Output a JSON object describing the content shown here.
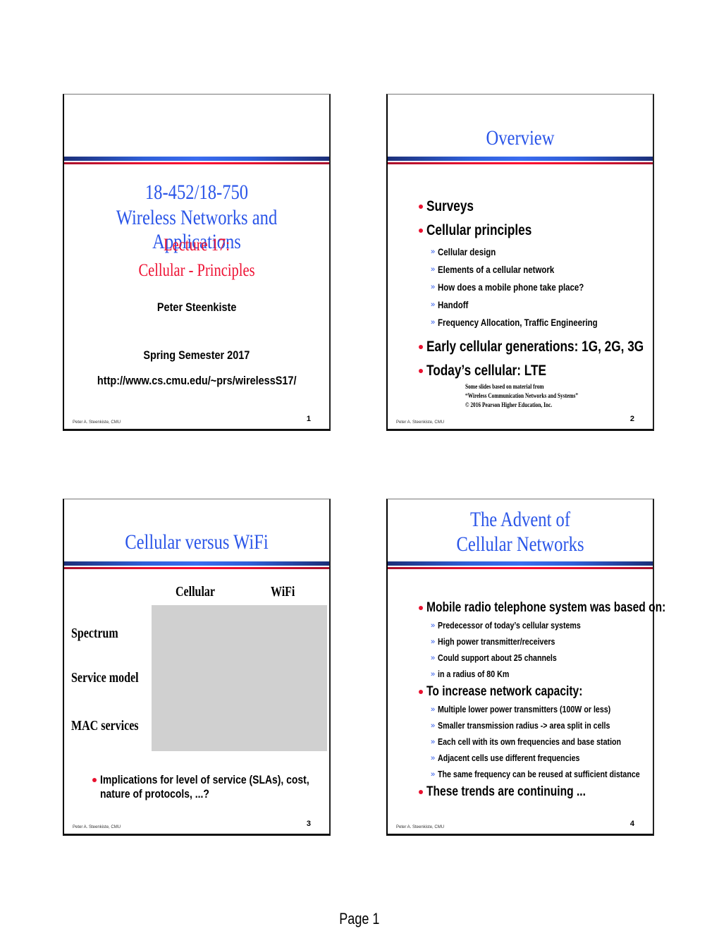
{
  "page": {
    "label": "Page 1"
  },
  "colors": {
    "title_blue": "#2a55e8",
    "accent_red": "#ee1133",
    "bullet_red": "#e8102e",
    "table_gray": "#d0d0d0"
  },
  "footer_author": "Peter A. Steenkiste, CMU",
  "slides": [
    {
      "number": "1",
      "course": "18-452/18-750",
      "course_title": "Wireless Networks and Applications",
      "lecture": "Lecture 17:",
      "topic": "Cellular - Principles",
      "author": "Peter Steenkiste",
      "semester": "Spring Semester 2017",
      "url": "http://www.cs.cmu.edu/~prs/wirelessS17/"
    },
    {
      "number": "2",
      "title": "Overview",
      "bullets": [
        {
          "text": "Surveys",
          "sub": []
        },
        {
          "text": "Cellular principles",
          "sub": [
            "Cellular design",
            "Elements of a cellular network",
            "How does a mobile phone take place?",
            "Handoff",
            "Frequency Allocation, Traffic Engineering"
          ]
        },
        {
          "text": "Early cellular generations: 1G, 2G, 3G",
          "sub": []
        },
        {
          "text": "Today’s cellular: LTE",
          "sub": []
        }
      ],
      "credit": [
        "Some slides based on material from",
        "“Wireless Communication Networks and Systems”",
        "© 2016 Pearson Higher Education, Inc."
      ]
    },
    {
      "number": "3",
      "title": "Cellular versus WiFi",
      "columns": [
        "Cellular",
        "WiFi"
      ],
      "rows": [
        "Spectrum",
        "Service model",
        "MAC services"
      ],
      "bullet_line1": "Implications for level of service (SLAs), cost,",
      "bullet_line2": "nature of protocols, ...?"
    },
    {
      "number": "4",
      "title_line1": "The Advent of",
      "title_line2": "Cellular Networks",
      "bullets": [
        {
          "text": "Mobile radio telephone system was based on:",
          "sub": [
            "Predecessor of today’s cellular systems",
            "High power transmitter/receivers",
            "Could support about 25 channels",
            "in a radius of 80 Km"
          ]
        },
        {
          "text": "To increase network capacity:",
          "sub": [
            "Multiple lower power transmitters (100W or less)",
            "Smaller transmission radius -> area split in cells",
            "Each cell with its own frequencies and base station",
            "Adjacent cells use different frequencies",
            "The same frequency can be reused at sufficient distance"
          ]
        },
        {
          "text": "These trends are continuing ...",
          "sub": []
        }
      ]
    }
  ]
}
